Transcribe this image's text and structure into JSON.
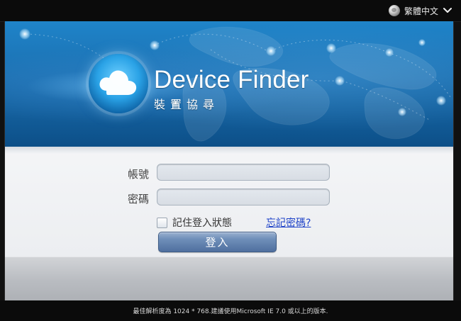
{
  "topbar": {
    "language": {
      "label": "繁體中文",
      "icon": "globe-icon",
      "dropdown_icon": "chevron-down-icon"
    }
  },
  "banner": {
    "title": "Device Finder",
    "subtitle": "裝置協尋",
    "logo_icon": "cloud-icon",
    "colors": {
      "banner_top": "#1f84c9",
      "banner_bottom": "#0c4f88",
      "accent_glow": "#6fd0ff"
    }
  },
  "login_form": {
    "account_label": "帳號",
    "password_label": "密碼",
    "account_value": "",
    "password_value": "",
    "remember_label": "記住登入狀態",
    "forgot_link": "忘記密碼?",
    "submit_label": "登入"
  },
  "footer": {
    "note": "最佳解析度為 1024 * 768.建議使用Microsoft IE 7.0 或以上的版本."
  }
}
